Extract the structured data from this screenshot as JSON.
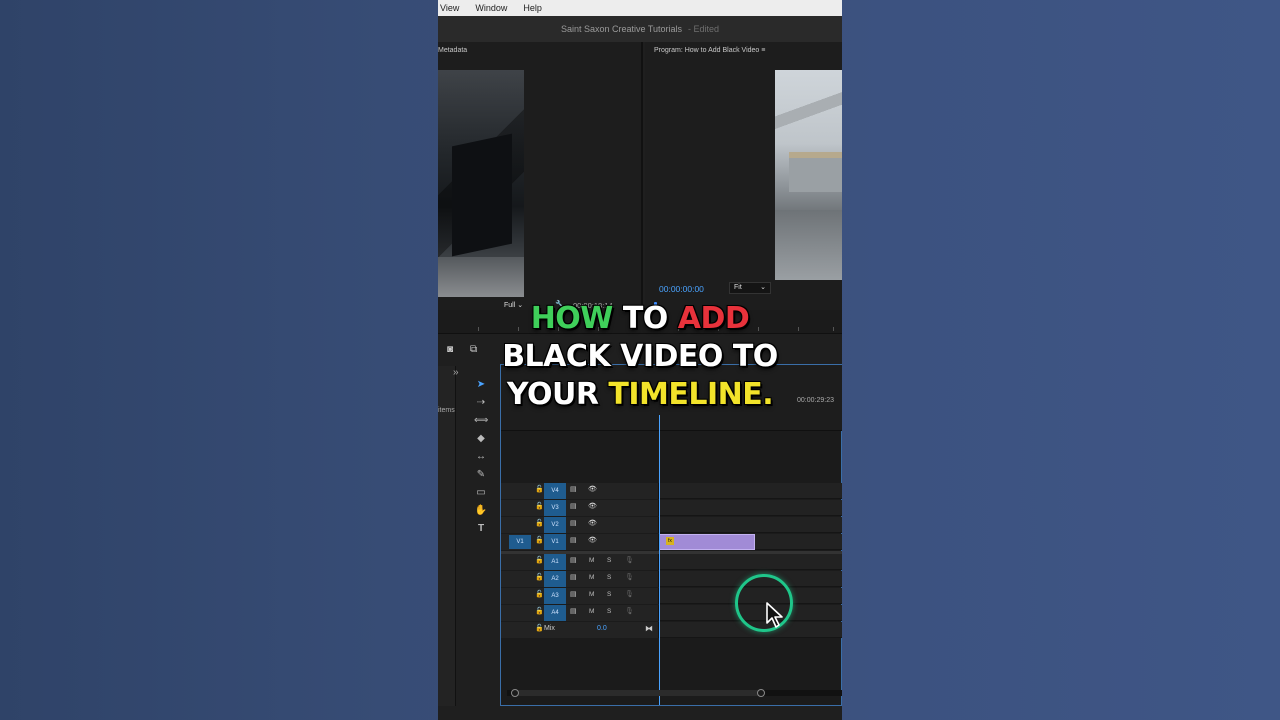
{
  "menubar": {
    "items": [
      "View",
      "Window",
      "Help"
    ]
  },
  "window": {
    "title": "Saint Saxon Creative Tutorials",
    "status": "- Edited"
  },
  "source_panel": {
    "tab_label": "Metadata",
    "resolution": "Full",
    "timecode": "00:00:18:14"
  },
  "program_panel": {
    "tab_label": "Program: How to Add Black Video",
    "menu_icon": "≡",
    "timecode": "00:00:00:00",
    "zoom": "Fit"
  },
  "project_panel": {
    "label": "items"
  },
  "timeline": {
    "end_timecode": "00:00:29:23",
    "video_tracks": [
      {
        "name": "V4"
      },
      {
        "name": "V3"
      },
      {
        "name": "V2"
      },
      {
        "name": "V1",
        "source": "V1"
      }
    ],
    "audio_tracks": [
      {
        "name": "A1",
        "mute": "M",
        "solo": "S"
      },
      {
        "name": "A2",
        "mute": "M",
        "solo": "S"
      },
      {
        "name": "A3",
        "mute": "M",
        "solo": "S"
      },
      {
        "name": "A4",
        "mute": "M",
        "solo": "S"
      }
    ],
    "mix": {
      "label": "Mix",
      "value": "0.0"
    },
    "clip": {
      "badge": "fx",
      "color": "#a18bd6"
    }
  },
  "overlay": {
    "line1": {
      "word1": "HOW",
      "word2": "TO",
      "word3": "ADD"
    },
    "line2": "BLACK VIDEO TO",
    "line3": {
      "word1": "YOUR",
      "word2": "TIMELINE."
    },
    "colors": {
      "green": "#3fcf5a",
      "red": "#e8323b",
      "yellow": "#f2e32a"
    }
  },
  "icons": {
    "tools": [
      "selection-tool-icon",
      "track-select-icon",
      "ripple-edit-icon",
      "razor-icon",
      "slip-icon",
      "pen-icon",
      "rectangle-icon",
      "hand-icon",
      "type-icon"
    ],
    "toolbar": [
      "camera-icon",
      "export-frame-icon"
    ]
  }
}
